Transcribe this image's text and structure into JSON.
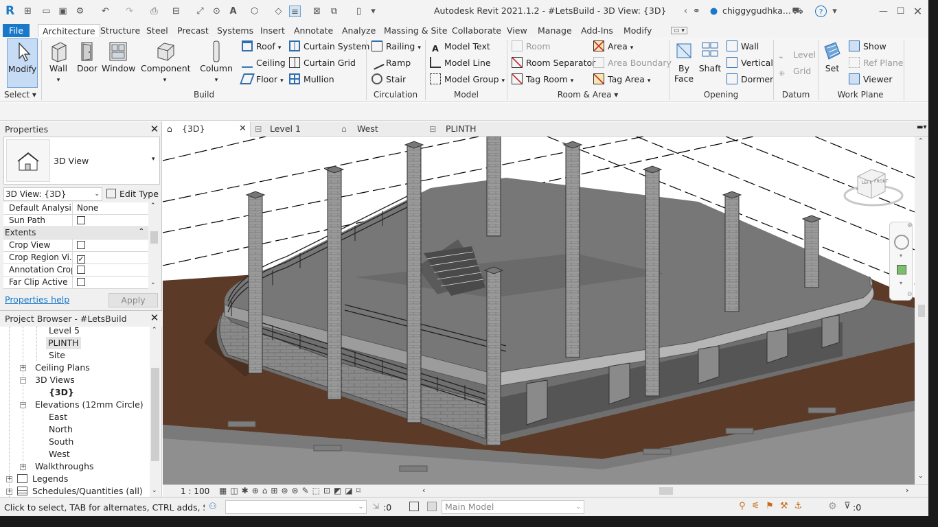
{
  "title_bar": {
    "app_title": "Autodesk Revit 2021.1.2 - #LetsBuild - 3D View: {3D}",
    "user": "chiggygudhka..."
  },
  "ribbon_tabs": [
    "File",
    "Architecture",
    "Structure",
    "Steel",
    "Precast",
    "Systems",
    "Insert",
    "Annotate",
    "Analyze",
    "Massing & Site",
    "Collaborate",
    "View",
    "Manage",
    "Add-Ins",
    "Modify"
  ],
  "ribbon": {
    "select": {
      "modify": "Modify",
      "panel": "Select"
    },
    "build": {
      "wall": "Wall",
      "door": "Door",
      "window": "Window",
      "component": "Component",
      "column": "Column",
      "roof": "Roof",
      "ceiling": "Ceiling",
      "floor": "Floor",
      "curtain_system": "Curtain System",
      "curtain_grid": "Curtain Grid",
      "mullion": "Mullion",
      "panel": "Build"
    },
    "circulation": {
      "railing": "Railing",
      "ramp": "Ramp",
      "stair": "Stair",
      "panel": "Circulation"
    },
    "model": {
      "model_text": "Model Text",
      "model_line": "Model Line",
      "model_group": "Model Group",
      "panel": "Model"
    },
    "room_area": {
      "room": "Room",
      "room_separator": "Room Separator",
      "tag_room": "Tag Room",
      "area": "Area",
      "area_boundary": "Area Boundary",
      "tag_area": "Tag Area",
      "panel": "Room & Area"
    },
    "opening": {
      "by_face_1": "By",
      "by_face_2": "Face",
      "shaft": "Shaft",
      "wall": "Wall",
      "vertical": "Vertical",
      "dormer": "Dormer",
      "panel": "Opening"
    },
    "datum": {
      "level": "Level",
      "grid": "Grid",
      "panel": "Datum"
    },
    "work_plane": {
      "set": "Set",
      "show": "Show",
      "ref_plane": "Ref Plane",
      "viewer": "Viewer",
      "panel": "Work Plane"
    }
  },
  "properties": {
    "header": "Properties",
    "type_name": "3D View",
    "instance_select": "3D View: {3D}",
    "edit_type": "Edit Type",
    "rows": [
      {
        "key": "Default Analysi...",
        "value": "None"
      },
      {
        "key": "Sun Path",
        "value": ""
      },
      {
        "key": "Extents",
        "value": ""
      },
      {
        "key": "Crop View",
        "value": ""
      },
      {
        "key": "Crop Region Vi...",
        "value": ""
      },
      {
        "key": "Annotation Crop",
        "value": ""
      },
      {
        "key": "Far Clip Active",
        "value": ""
      }
    ],
    "help": "Properties help",
    "apply": "Apply"
  },
  "project_browser": {
    "header": "Project Browser - #LetsBuild",
    "items": [
      "Level 5",
      "PLINTH",
      "Site",
      "Ceiling Plans",
      "3D Views",
      "{3D}",
      "Elevations (12mm Circle)",
      "East",
      "North",
      "South",
      "West",
      "Walkthroughs",
      "Legends",
      "Schedules/Quantities (all)"
    ]
  },
  "view_tabs": [
    "{3D}",
    "Level 1",
    "West",
    "PLINTH"
  ],
  "view_controls": {
    "scale": "1 : 100"
  },
  "viewcube": {
    "left": "LEFT",
    "front": "FRONT"
  },
  "status_bar": {
    "message": "Click to select, TAB for alternates, CTRL adds, SHIFT unse",
    "zero1": ":0",
    "model": "Main Model",
    "zero2": ":0"
  }
}
